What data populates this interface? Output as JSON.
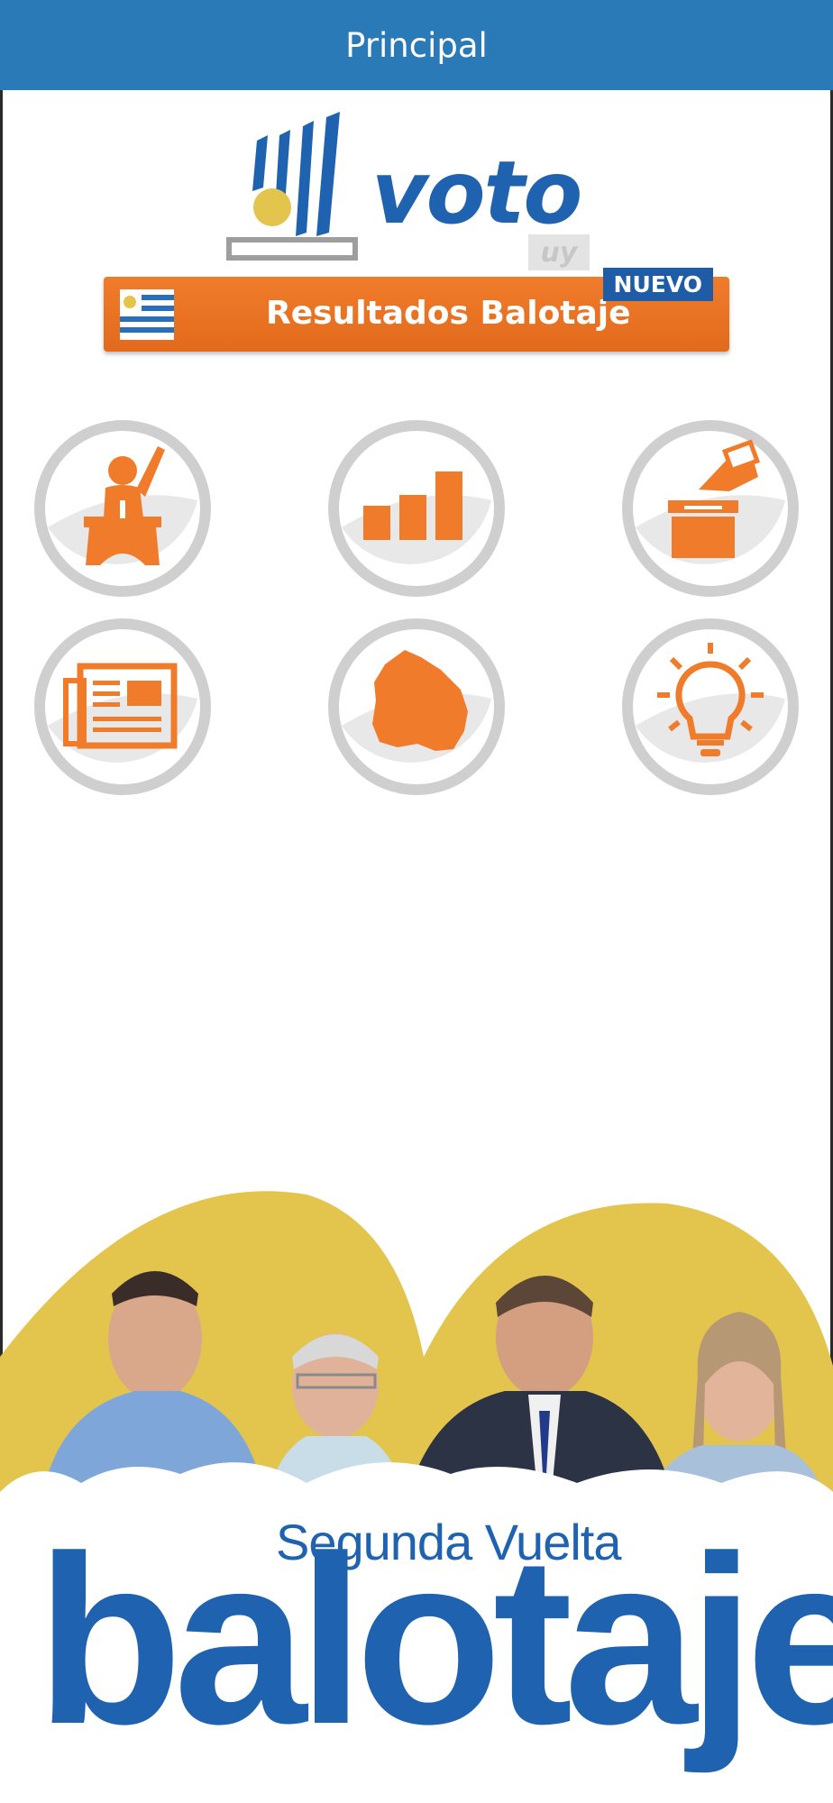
{
  "header": {
    "title": "Principal"
  },
  "logo": {
    "word": "voto",
    "suffix": "uy"
  },
  "banner": {
    "label": "Resultados Balotaje",
    "badge": "NUEVO"
  },
  "menu": {
    "items": [
      {
        "icon": "candidate-podium-icon"
      },
      {
        "icon": "bar-chart-icon"
      },
      {
        "icon": "ballot-box-icon"
      },
      {
        "icon": "newspaper-icon"
      },
      {
        "icon": "uruguay-map-icon"
      },
      {
        "icon": "lightbulb-icon"
      }
    ]
  },
  "promo": {
    "subtitle": "Segunda Vuelta",
    "title": "balotaje"
  },
  "colors": {
    "brand_blue": "#1f63b0",
    "header_blue": "#2a7ab8",
    "accent_orange": "#f07c2b",
    "promo_yellow": "#e3c44c"
  }
}
